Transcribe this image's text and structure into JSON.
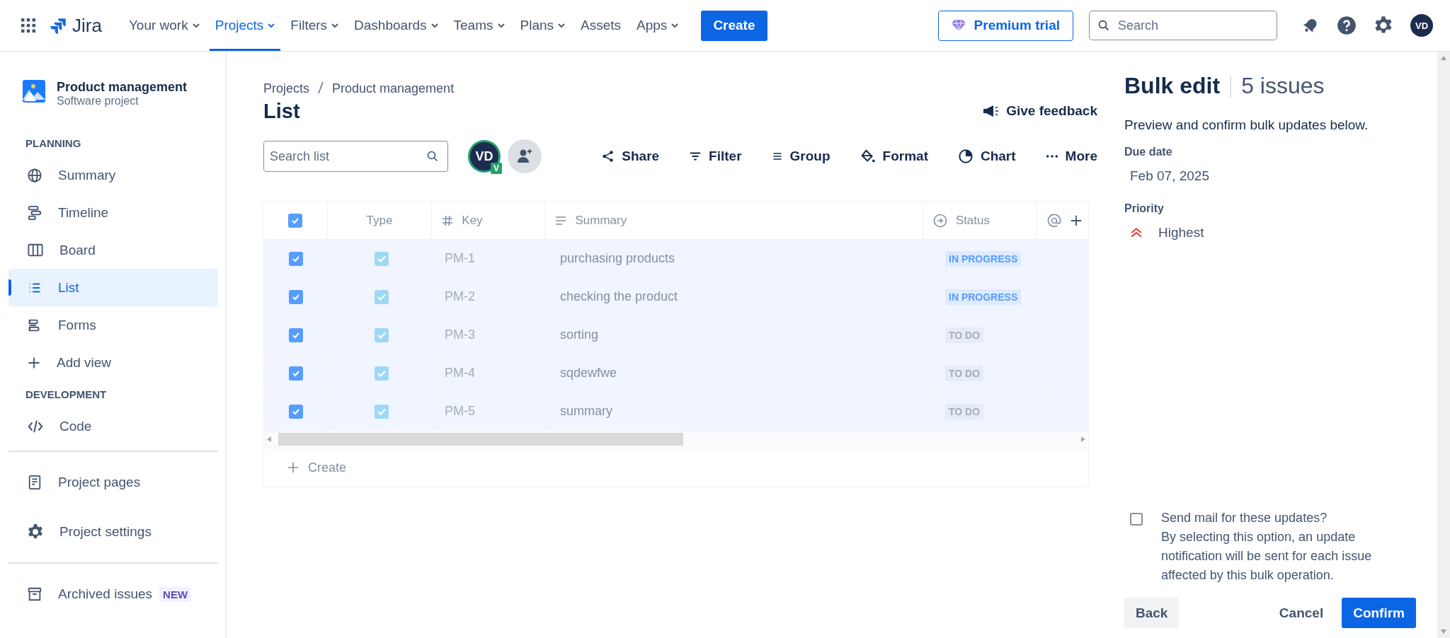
{
  "top_nav": {
    "product": "Jira",
    "items": [
      {
        "label": "Your work",
        "menu": true,
        "selected": false
      },
      {
        "label": "Projects",
        "menu": true,
        "selected": true
      },
      {
        "label": "Filters",
        "menu": true,
        "selected": false
      },
      {
        "label": "Dashboards",
        "menu": true,
        "selected": false
      },
      {
        "label": "Teams",
        "menu": true,
        "selected": false
      },
      {
        "label": "Plans",
        "menu": true,
        "selected": false
      },
      {
        "label": "Assets",
        "menu": false,
        "selected": false
      },
      {
        "label": "Apps",
        "menu": true,
        "selected": false
      }
    ],
    "create": "Create",
    "premium": "Premium trial",
    "search": {
      "placeholder": "Search"
    },
    "avatar": "VD"
  },
  "sidebar": {
    "project": {
      "name": "Product management",
      "type": "Software project"
    },
    "sections": [
      {
        "title": "PLANNING",
        "items": [
          {
            "label": "Summary",
            "selected": false
          },
          {
            "label": "Timeline",
            "selected": false
          },
          {
            "label": "Board",
            "selected": false
          },
          {
            "label": "List",
            "selected": true
          },
          {
            "label": "Forms",
            "selected": false
          }
        ]
      },
      {
        "title": "DEVELOPMENT",
        "items": [
          {
            "label": "Code",
            "selected": false
          }
        ]
      }
    ],
    "add_view": "Add view",
    "footer": [
      {
        "label": "Project pages"
      },
      {
        "label": "Project settings"
      },
      {
        "label": "Archived issues",
        "badge": "NEW"
      }
    ]
  },
  "main": {
    "breadcrumbs": [
      "Projects",
      "Product management"
    ],
    "title": "List",
    "feedback": "Give feedback",
    "search": {
      "placeholder": "Search list"
    },
    "avatar": {
      "initials": "VD",
      "badge": "V"
    },
    "toolbar": [
      "Share",
      "Filter",
      "Group",
      "Format",
      "Chart",
      "More"
    ],
    "table": {
      "all_checked": true,
      "columns": [
        "Type",
        "Key",
        "Summary",
        "Status"
      ],
      "rows": [
        {
          "selected": true,
          "key": "PM-1",
          "summary": "purchasing products",
          "status": "IN PROGRESS",
          "color": "#579dff"
        },
        {
          "selected": true,
          "key": "PM-2",
          "summary": "checking the product",
          "status": "IN PROGRESS",
          "color": "#579dff"
        },
        {
          "selected": true,
          "key": "PM-3",
          "summary": "sorting",
          "status": "TO DO",
          "color": "#a5adba"
        },
        {
          "selected": true,
          "key": "PM-4",
          "summary": "sqdewfwe",
          "status": "TO DO",
          "color": "#a5adba"
        },
        {
          "selected": true,
          "key": "PM-5",
          "summary": "summary",
          "status": "TO DO",
          "color": "#a5adba"
        }
      ],
      "create": "Create"
    }
  },
  "bulk_edit": {
    "title": "Bulk edit",
    "count": "5 issues",
    "intro": "Preview and confirm bulk updates below.",
    "fields": [
      {
        "label": "Due date",
        "value": "Feb 07, 2025",
        "kind": "date"
      },
      {
        "label": "Priority",
        "value": "Highest",
        "kind": "priority"
      }
    ],
    "send_mail": {
      "checked": false,
      "label": "Send mail for these updates?",
      "note": "By selecting this option, an update notification will be sent for each issue affected by this bulk operation."
    },
    "buttons": {
      "back": "Back",
      "cancel": "Cancel",
      "confirm": "Confirm"
    }
  }
}
